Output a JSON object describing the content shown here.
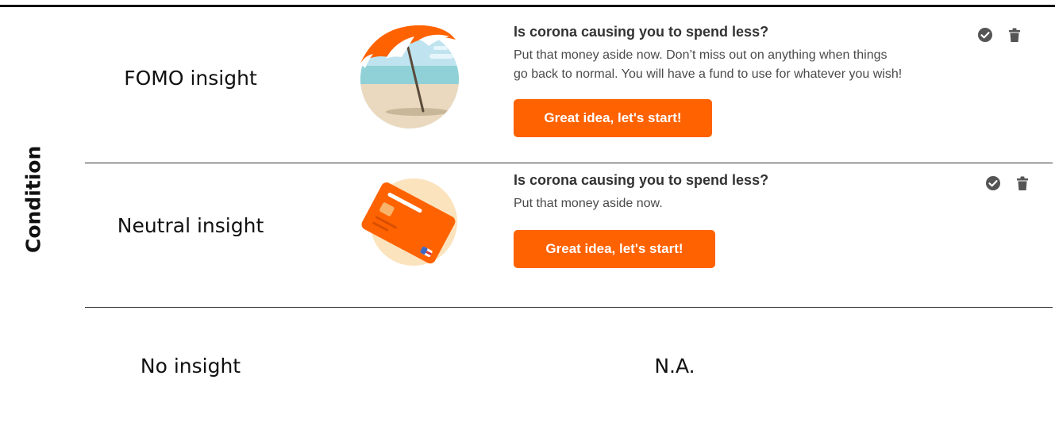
{
  "axis": {
    "label": "Condition"
  },
  "rows": [
    {
      "condition": "FOMO insight",
      "illustration": "beach-umbrella-illustration",
      "title": "Is corona causing you to spend less?",
      "body_line1": "Put that money aside now. Don’t miss out on anything when things",
      "body_line2": "go back to normal. You will have a fund to use for whatever you wish!",
      "cta": "Great idea, let's start!",
      "actions": [
        "check-circle-icon",
        "trash-icon"
      ]
    },
    {
      "condition": "Neutral insight",
      "illustration": "credit-card-illustration",
      "title": "Is corona causing you to spend less?",
      "body_line1": "Put that money aside now.",
      "cta": "Great idea, let's start!",
      "actions": [
        "check-circle-icon",
        "trash-icon"
      ]
    },
    {
      "condition": "No insight",
      "placeholder": "N.A."
    }
  ],
  "colors": {
    "accent": "#ff6200",
    "text": "#333333",
    "icon": "#555555"
  }
}
